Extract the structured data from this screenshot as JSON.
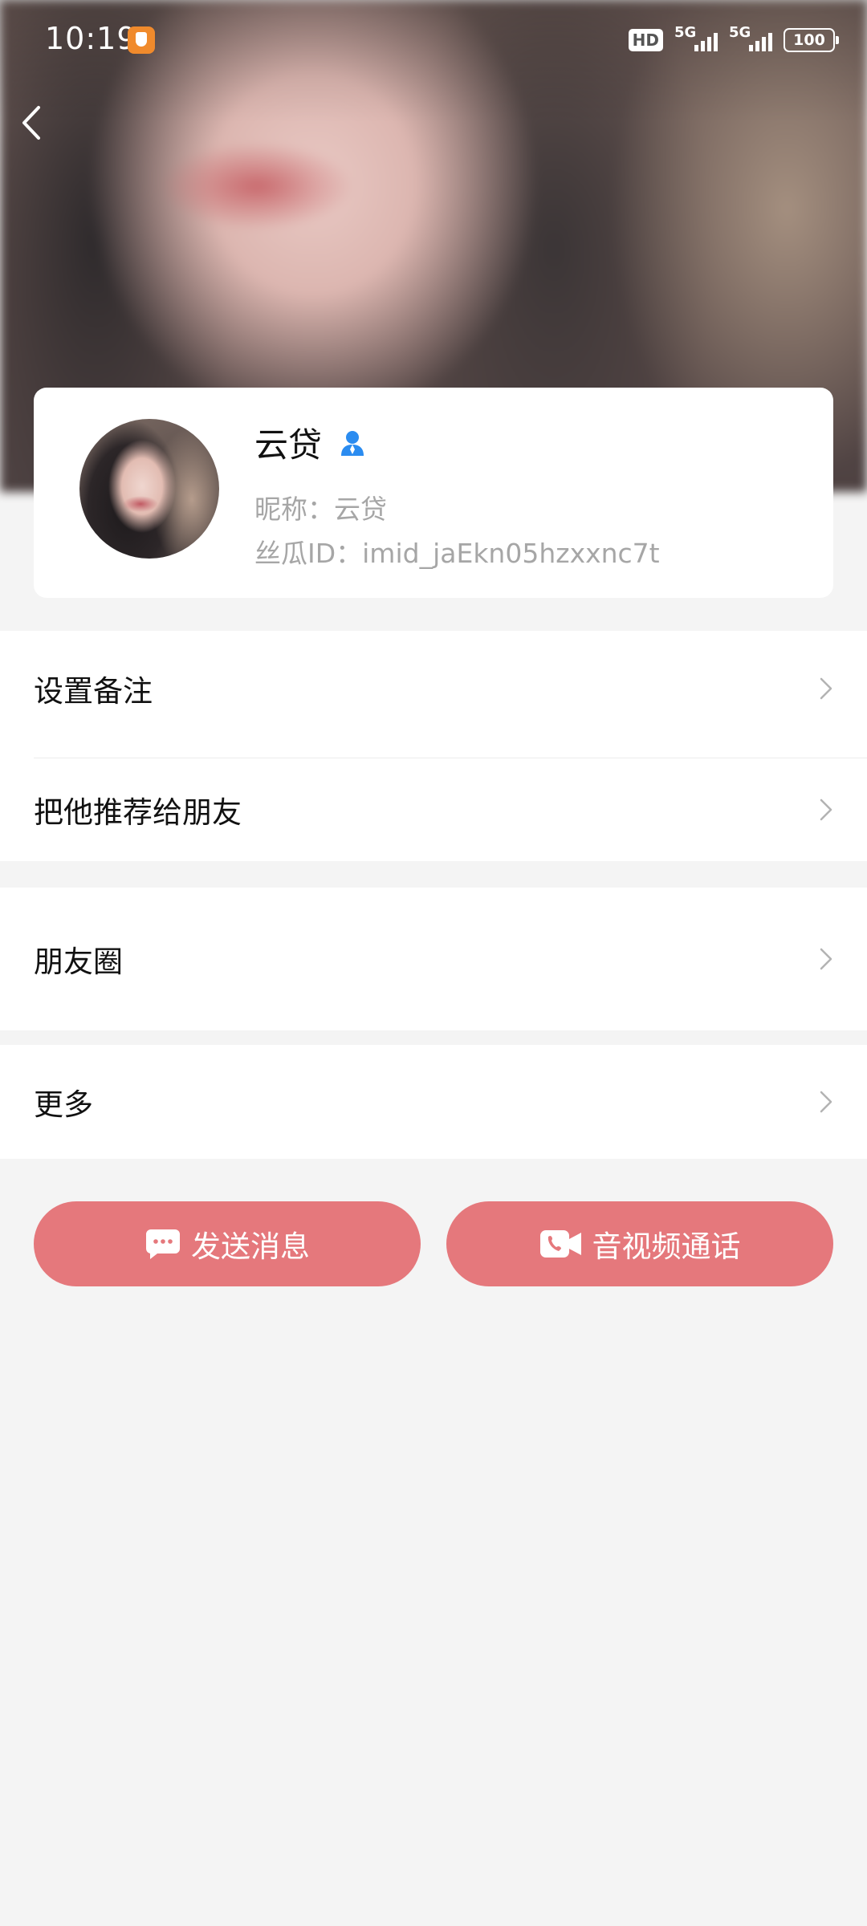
{
  "status_bar": {
    "time": "10:19",
    "hd_label": "HD",
    "signal1_label": "5G",
    "signal2_label": "5G",
    "battery": "100"
  },
  "header": {
    "back_icon": "chevron-left-icon"
  },
  "profile": {
    "name": "云贷",
    "verified_icon": "user-icon",
    "nickname": "昵称：云贷",
    "id_line": "丝瓜ID：imid_jaEkn05hzxxnc7t"
  },
  "menu": {
    "group1": [
      {
        "label": "设置备注"
      },
      {
        "label": "把他推荐给朋友"
      }
    ],
    "group2": [
      {
        "label": "朋友圈"
      }
    ],
    "group3": [
      {
        "label": "更多"
      }
    ]
  },
  "actions": {
    "send_message": "发送消息",
    "av_call": "音视频通话"
  },
  "colors": {
    "accent_button": "#e5787c",
    "verified_blue": "#2b8cf0",
    "page_bg": "#f4f4f4"
  }
}
